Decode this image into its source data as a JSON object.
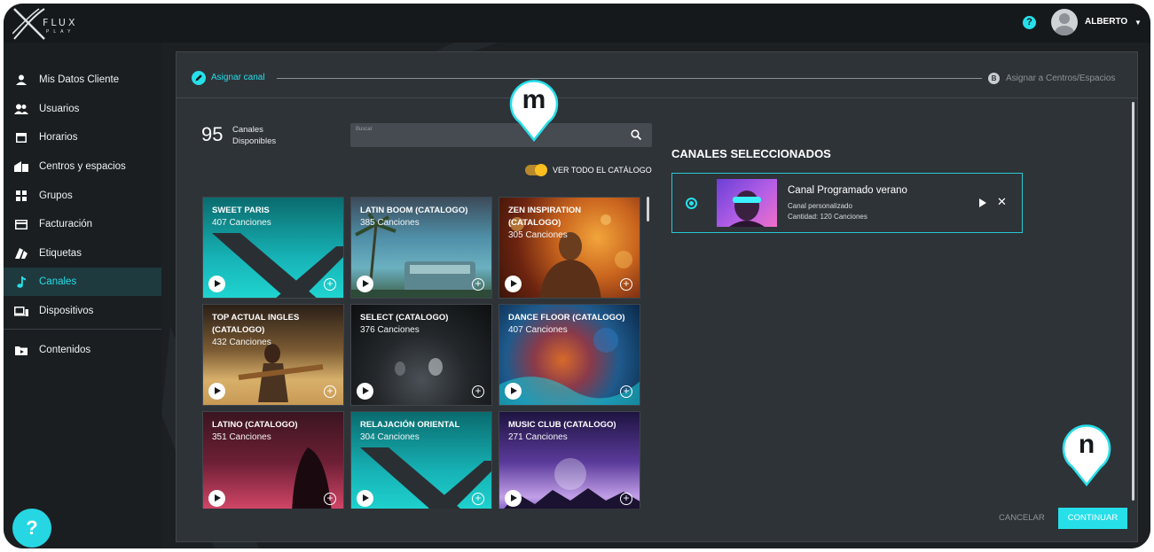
{
  "app": {
    "logo_text": "FLUX",
    "logo_sub": "PLAY",
    "username": "ALBERTO"
  },
  "colors": {
    "accent": "#26dfe9",
    "toggle": "#ffbf1f",
    "panel": "#2e3338"
  },
  "sidebar": {
    "items": [
      {
        "label": "Mis Datos Cliente",
        "icon": "user-icon"
      },
      {
        "label": "Usuarios",
        "icon": "users-icon"
      },
      {
        "label": "Horarios",
        "icon": "calendar-icon"
      },
      {
        "label": "Centros y espacios",
        "icon": "building-icon"
      },
      {
        "label": "Grupos",
        "icon": "grid-icon"
      },
      {
        "label": "Facturación",
        "icon": "credit-card-icon"
      },
      {
        "label": "Etiquetas",
        "icon": "tag-icon"
      },
      {
        "label": "Canales",
        "icon": "music-note-icon",
        "active": true
      },
      {
        "label": "Dispositivos",
        "icon": "devices-icon"
      },
      {
        "label": "Contenidos",
        "icon": "folder-icon"
      }
    ]
  },
  "stepper": {
    "step1_label": "Asignar canal",
    "step2_badge": "B",
    "step2_label": "Asignar a Centros/Espacios"
  },
  "available": {
    "count": "95",
    "label": "Canales Disponibles"
  },
  "search": {
    "placeholder": "Buscar"
  },
  "catalog_toggle": {
    "label": "VER TODO EL CATÁLOGO",
    "on": true
  },
  "channels": [
    {
      "title": "SWEET PARIS",
      "count": "407 Canciones",
      "art": "teal-logo"
    },
    {
      "title": "LATIN BOOM (CATALOGO)",
      "count": "385 Canciones",
      "art": "beach"
    },
    {
      "title": "ZEN INSPIRATION (CATALOGO)",
      "count": "305 Canciones",
      "art": "buddha"
    },
    {
      "title": "TOP ACTUAL INGLES (CATALOGO)",
      "count": "432 Canciones",
      "art": "guitar"
    },
    {
      "title": "SELECT (CATALOGO)",
      "count": "376 Canciones",
      "art": "dark"
    },
    {
      "title": "DANCE FLOOR (CATALOGO)",
      "count": "407 Canciones",
      "art": "dance"
    },
    {
      "title": "LATINO (CATALOGO)",
      "count": "351 Canciones",
      "art": "latino"
    },
    {
      "title": "RELAJACIÓN ORIENTAL",
      "count": "304 Canciones",
      "art": "teal-logo"
    },
    {
      "title": "MUSIC CLUB (CATALOGO)",
      "count": "271 Canciones",
      "art": "club"
    }
  ],
  "selected": {
    "heading": "CANALES SELECCIONADOS",
    "name": "Canal Programado verano",
    "type": "Canal personalizado",
    "quantity": "Cantidad: 120 Canciones"
  },
  "actions": {
    "cancel": "CANCELAR",
    "continue": "CONTINUAR"
  },
  "markers": {
    "m": "m",
    "n": "n"
  },
  "help_label": "?"
}
